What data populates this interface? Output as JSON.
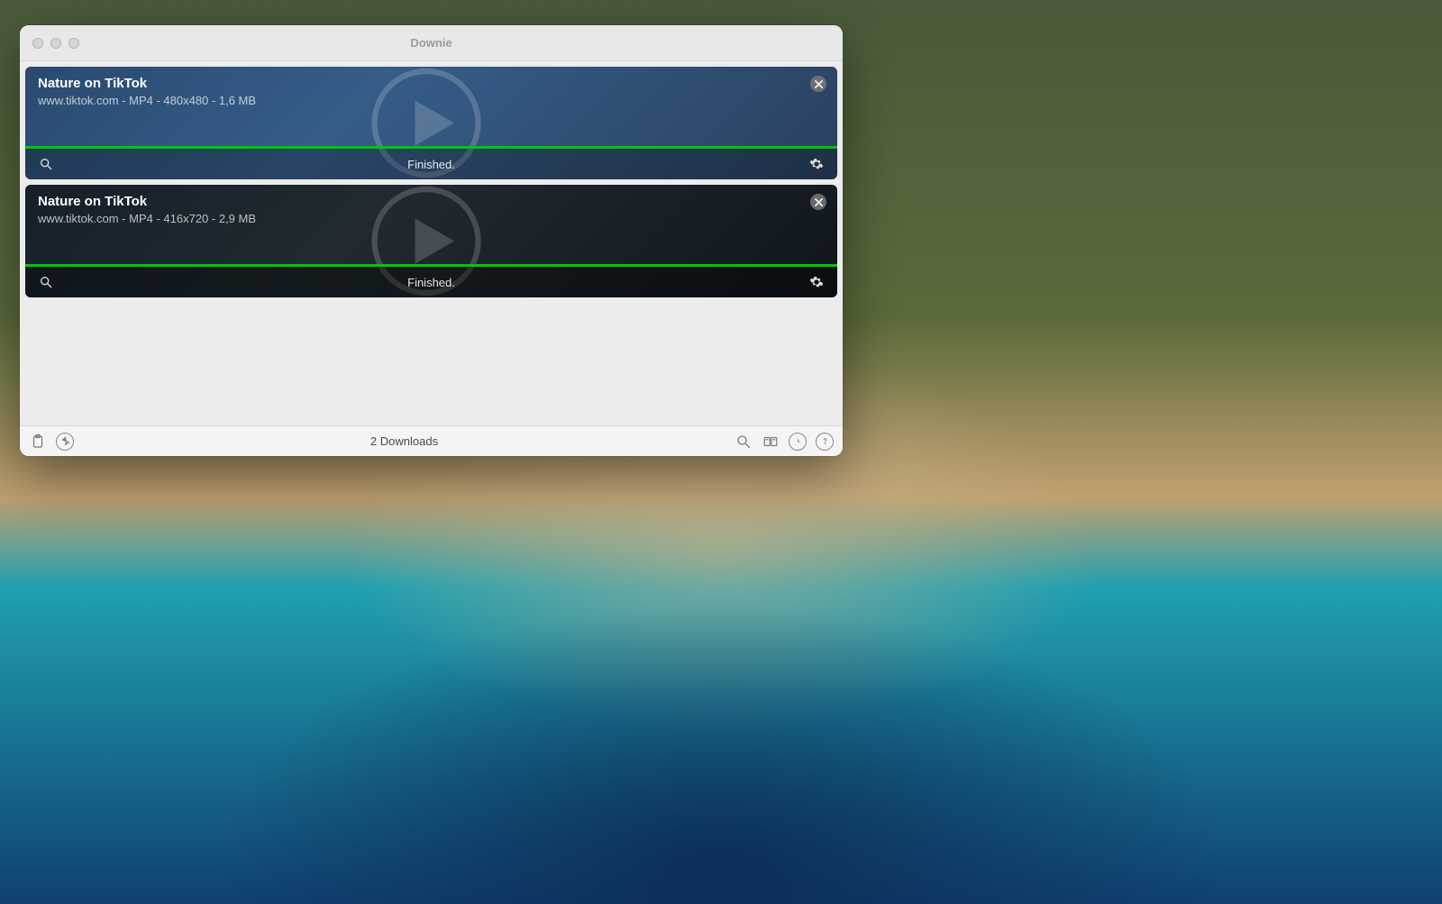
{
  "window": {
    "title": "Downie"
  },
  "downloads": [
    {
      "title": "Nature on TikTok",
      "meta": "www.tiktok.com - MP4 - 480x480 - 1,6 MB",
      "status": "Finished.",
      "variant": "blue"
    },
    {
      "title": "Nature on TikTok",
      "meta": "www.tiktok.com - MP4 - 416x720 - 2,9 MB",
      "status": "Finished.",
      "variant": "dark"
    }
  ],
  "footer": {
    "count_label": "2 Downloads"
  }
}
